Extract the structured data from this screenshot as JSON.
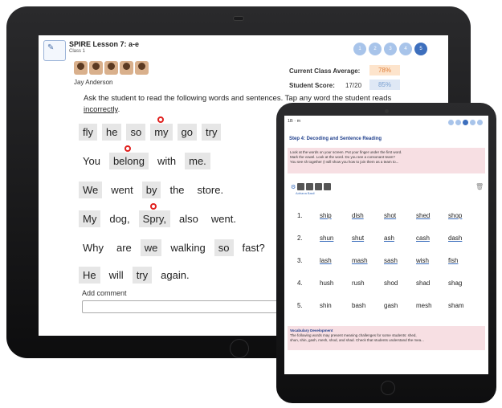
{
  "big": {
    "title": "SPIRE Lesson 7: a-e",
    "class_label": "Class 1",
    "nav": [
      "1",
      "2",
      "3",
      "4",
      "5"
    ],
    "student_name": "Jay Anderson",
    "class_avg_label": "Current Class Average:",
    "class_avg_value": "78%",
    "score_label": "Student Score:",
    "score_fraction": "17/20",
    "score_percent": "85%",
    "instructions_pre": "Ask the student to read the following words and sentences.  Tap any word the student reads ",
    "instructions_underline": "incorrectly",
    "instructions_post": ".",
    "lines": [
      [
        {
          "t": "fly",
          "box": true
        },
        {
          "t": "he",
          "box": true
        },
        {
          "t": "so",
          "box": true
        },
        {
          "t": "my",
          "box": true,
          "mark": true
        },
        {
          "t": "go",
          "box": true
        },
        {
          "t": "try",
          "box": true
        }
      ],
      [
        {
          "t": "You",
          "box": false
        },
        {
          "t": "belong",
          "box": true,
          "mark": true
        },
        {
          "t": "with",
          "box": false
        },
        {
          "t": "me.",
          "box": true
        }
      ],
      [
        {
          "t": "We",
          "box": true
        },
        {
          "t": "went",
          "box": false
        },
        {
          "t": "by",
          "box": true
        },
        {
          "t": "the",
          "box": false
        },
        {
          "t": "store.",
          "box": false
        }
      ],
      [
        {
          "t": "My",
          "box": true
        },
        {
          "t": "dog,",
          "box": false
        },
        {
          "t": "Spry,",
          "box": true,
          "mark": true
        },
        {
          "t": "also",
          "box": false
        },
        {
          "t": "went.",
          "box": false
        }
      ],
      [
        {
          "t": "Why",
          "box": false
        },
        {
          "t": "are",
          "box": false
        },
        {
          "t": "we",
          "box": true
        },
        {
          "t": "walking",
          "box": false
        },
        {
          "t": "so",
          "box": true
        },
        {
          "t": "fast?",
          "box": false
        }
      ],
      [
        {
          "t": "He",
          "box": true
        },
        {
          "t": "will",
          "box": false
        },
        {
          "t": "try",
          "box": true
        },
        {
          "t": "again.",
          "box": false
        }
      ]
    ],
    "comment_label": "Add comment"
  },
  "small": {
    "header": "1B · m",
    "step_title": "Step 4: Decoding and Sentence Reading",
    "pink_lines": [
      "Look at the words on your screen. Put your finger under the first word.",
      "Mark the vowel. Look at the word. Do you see a consonant team?",
      "You see sh together (I will show you how to join them as a team to..."
    ],
    "roster_label": "Adriana Basil",
    "rows": [
      {
        "n": "1.",
        "w": [
          "ship",
          "dish",
          "shot",
          "shed",
          "shop"
        ]
      },
      {
        "n": "2.",
        "w": [
          "shun",
          "shut",
          "ash",
          "cash",
          "dash"
        ]
      },
      {
        "n": "3.",
        "w": [
          "lash",
          "mash",
          "sash",
          "wish",
          "fish"
        ]
      },
      {
        "n": "4.",
        "w": [
          "hush",
          "rush",
          "shod",
          "shad",
          "shag"
        ]
      },
      {
        "n": "5.",
        "w": [
          "shin",
          "bash",
          "gash",
          "mesh",
          "sham"
        ]
      }
    ],
    "vocab_title": "Vocabulary Development",
    "vocab_lines": [
      "The following words may present meaning challenges for some students: shed,",
      "shun, shin, gash, mesh, shod, and shad. Check that students understand the mea..."
    ]
  }
}
